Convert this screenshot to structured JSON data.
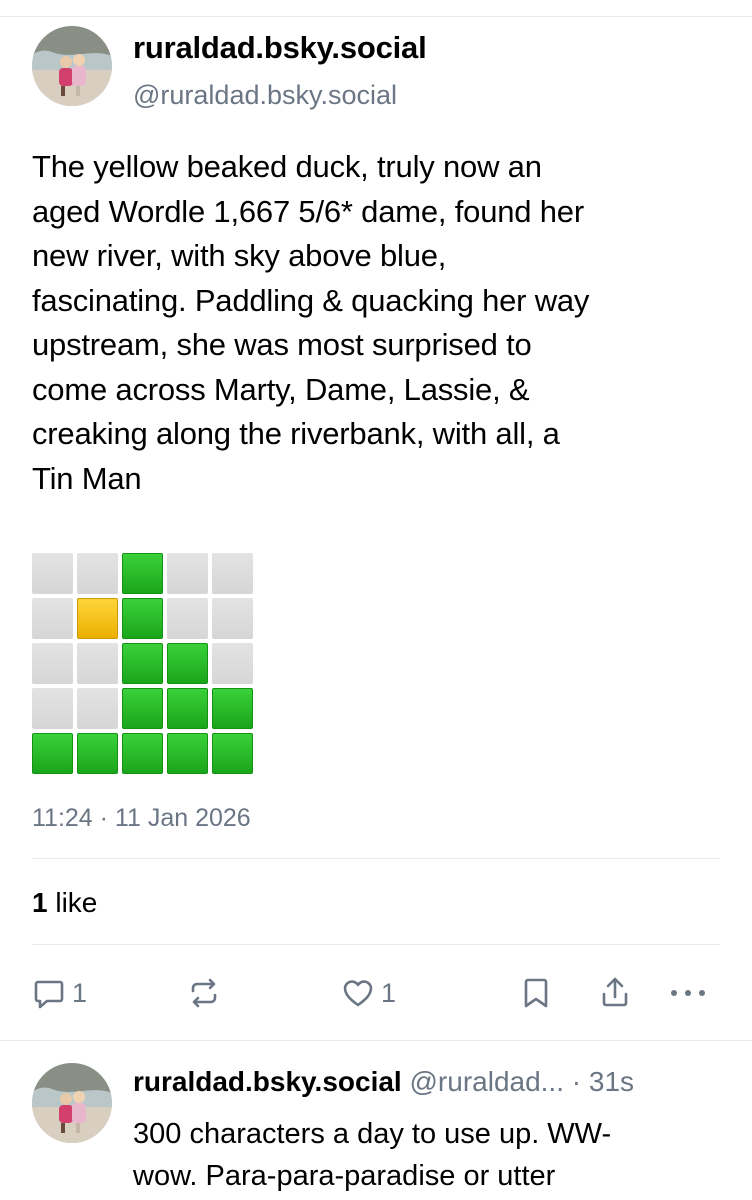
{
  "post": {
    "display_name": "ruraldad.bsky.social",
    "handle": "@ruraldad.bsky.social",
    "text_lines": [
      "The yellow beaked duck, truly now an",
      "aged Wordle 1,667 5/6* dame, found her",
      "new river, with sky above blue,",
      "fascinating. Paddling & quacking her way",
      "upstream, she was most surprised to",
      "come across Marty, Dame, Lassie, &",
      "creaking along the riverbank, with all, a",
      "Tin Man"
    ],
    "wordle_grid": [
      [
        "gray",
        "gray",
        "green",
        "gray",
        "gray"
      ],
      [
        "gray",
        "yellow",
        "green",
        "gray",
        "gray"
      ],
      [
        "gray",
        "gray",
        "green",
        "green",
        "gray"
      ],
      [
        "gray",
        "gray",
        "green",
        "green",
        "green"
      ],
      [
        "green",
        "green",
        "green",
        "green",
        "green"
      ]
    ],
    "timestamp": "11:24 · 11 Jan 2026",
    "likes_count": "1",
    "likes_label": "like"
  },
  "actions": {
    "reply_count": "1",
    "like_count": "1",
    "icons": [
      "reply-icon",
      "repost-icon",
      "like-icon",
      "bookmark-icon",
      "share-icon",
      "more-icon"
    ]
  },
  "reply": {
    "display_name": "ruraldad.bsky.social",
    "handle": "@ruraldad...",
    "time": "· 31s",
    "text_lines": [
      "300 characters a day to use up.  WW-",
      "wow.  Para-para-paradise or utter"
    ]
  },
  "colors": {
    "muted_text": "#6b7684",
    "wordle_green": "#1aa51a",
    "wordle_yellow": "#eab000",
    "wordle_gray": "#d6d6d6"
  }
}
